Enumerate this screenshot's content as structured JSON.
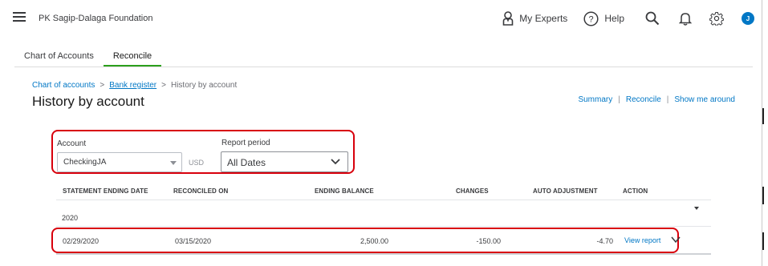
{
  "header": {
    "company_name": "PK Sagip-Dalaga Foundation",
    "my_experts_label": "My Experts",
    "help_label": "Help",
    "avatar_initial": "J",
    "icons": [
      "menu-icon",
      "person-icon",
      "help-icon",
      "search-icon",
      "bell-icon",
      "gear-icon"
    ]
  },
  "tabs": [
    {
      "label": "Chart of Accounts",
      "active": false
    },
    {
      "label": "Reconcile",
      "active": true
    }
  ],
  "breadcrumb": {
    "item1": "Chart of accounts",
    "sep": ">",
    "item2": "Bank register",
    "item3": "History by account"
  },
  "page_title": "History by account",
  "top_links": {
    "summary": "Summary",
    "reconcile": "Reconcile",
    "show_me_around": "Show me around",
    "divider": "|"
  },
  "filters": {
    "account_label": "Account",
    "account_value": "CheckingJA",
    "currency": "USD",
    "period_label": "Report period",
    "period_value": "All Dates"
  },
  "table": {
    "columns": {
      "statement_ending_date": "STATEMENT ENDING DATE",
      "reconciled_on": "RECONCILED ON",
      "ending_balance": "ENDING BALANCE",
      "changes": "CHANGES",
      "auto_adjustment": "AUTO ADJUSTMENT",
      "action": "ACTION"
    },
    "group": "2020",
    "rows": [
      {
        "statement_ending_date": "02/29/2020",
        "reconciled_on": "03/15/2020",
        "ending_balance": "2,500.00",
        "changes": "-150.00",
        "auto_adjustment": "-4.70",
        "action": "View report"
      }
    ]
  },
  "colors": {
    "accent_blue": "#0077c5",
    "active_tab_green": "#2ca01c",
    "highlight_red": "#d8000c"
  }
}
